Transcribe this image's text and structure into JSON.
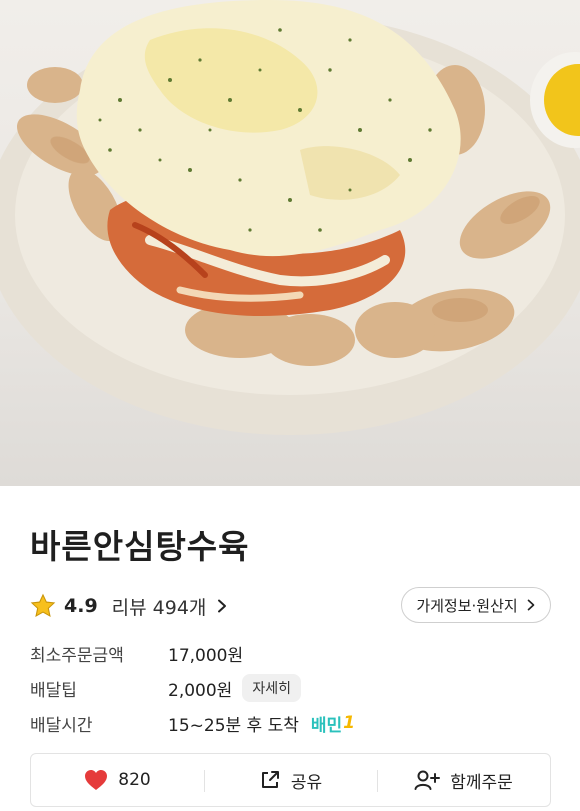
{
  "store": {
    "name": "바른안심탕수육",
    "rating": "4.9",
    "reviews_label": "리뷰 494개"
  },
  "info_button": {
    "label": "가게정보·원산지"
  },
  "details": {
    "min_order": {
      "label": "최소주문금액",
      "value": "17,000원"
    },
    "delivery_tip": {
      "label": "배달팁",
      "value": "2,000원",
      "detail_label": "자세히"
    },
    "delivery_time": {
      "label": "배달시간",
      "value": "15~25분 후 도착",
      "badge": "배민",
      "badge_suffix": "1"
    }
  },
  "actions": {
    "like_count": "820",
    "share_label": "공유",
    "group_order_label": "함께주문"
  },
  "colors": {
    "heart": "#e53b3b",
    "star": "#f7c01d",
    "baemin": "#2ac1bc"
  }
}
